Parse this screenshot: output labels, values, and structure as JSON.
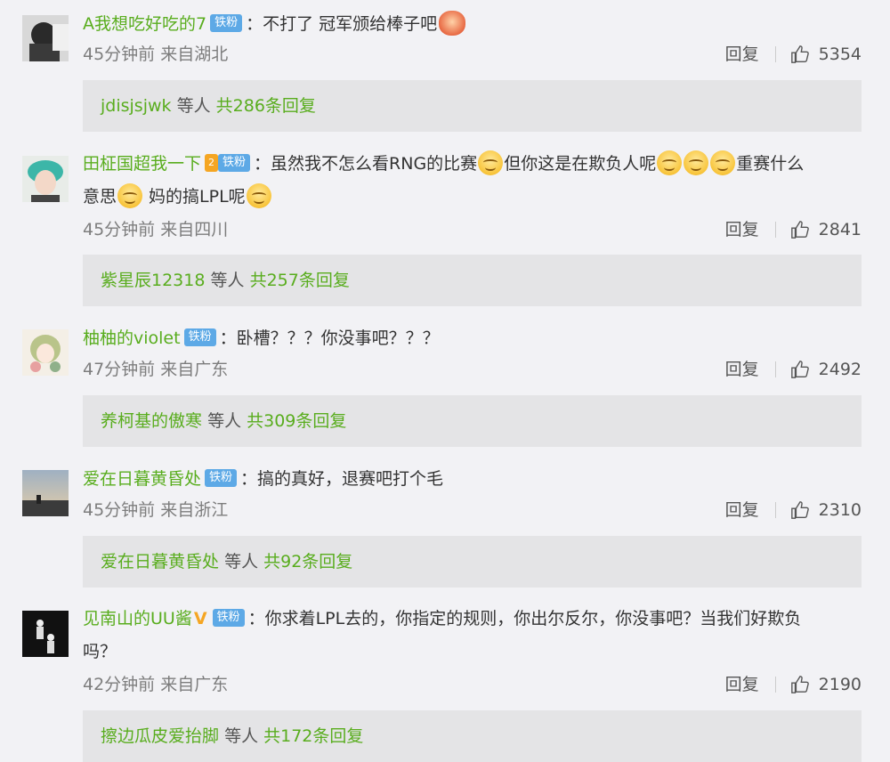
{
  "comments": [
    {
      "username": "A我想吃好吃的7",
      "badge": "铁粉",
      "text": "不打了 冠军颁给棒子吧",
      "time": "45分钟前",
      "location": "来自湖北",
      "reply_label": "回复",
      "likes": "5354",
      "reply_users": "jdisjsjwk",
      "reply_etc": "等人",
      "reply_count": "共286条回复"
    },
    {
      "username": "田柾国超我一下",
      "crown": "2",
      "badge": "铁粉",
      "text_line1_a": "虽然我不怎么看RNG的比赛",
      "text_line1_b": "但你这是在欺负人呢",
      "text_line1_c": "重赛什么",
      "text_line2_a": "意思",
      "text_line2_b": " 妈的搞LPL呢",
      "time": "45分钟前",
      "location": "来自四川",
      "reply_label": "回复",
      "likes": "2841",
      "reply_users": "紫星辰12318",
      "reply_etc": "等人",
      "reply_count": "共257条回复"
    },
    {
      "username": "柚柚的violet",
      "badge": "铁粉",
      "text": "卧槽？？？你没事吧？？？",
      "time": "47分钟前",
      "location": "来自广东",
      "reply_label": "回复",
      "likes": "2492",
      "reply_users": "养柯基的傲寒",
      "reply_etc": "等人",
      "reply_count": "共309条回复"
    },
    {
      "username": "爱在日暮黄昏处",
      "badge": "铁粉",
      "text": "搞的真好，退赛吧打个毛",
      "time": "45分钟前",
      "location": "来自浙江",
      "reply_label": "回复",
      "likes": "2310",
      "reply_users": "爱在日暮黄昏处",
      "reply_etc": "等人",
      "reply_count": "共92条回复"
    },
    {
      "username": "见南山的UU酱",
      "vmark": "V",
      "badge": "铁粉",
      "text_line1": "你求着LPL去的，你指定的规则，你出尔反尔，你没事吧？当我们好欺负",
      "text_line2": "吗？",
      "time": "42分钟前",
      "location": "来自广东",
      "reply_label": "回复",
      "likes": "2190",
      "reply_users": "擦边瓜皮爱抬脚",
      "reply_etc": "等人",
      "reply_count": "共172条回复"
    }
  ],
  "colors": {
    "username": "#59ad1e",
    "badge": "#5da9e6",
    "background": "#f2f2f5",
    "reply_bar": "#e4e4e6"
  },
  "icons": [
    "avatar",
    "fan-badge",
    "crown-badge",
    "verified-v-icon",
    "smile-emoji-icon",
    "angry-emoji-icon",
    "thumbs-up-icon"
  ]
}
